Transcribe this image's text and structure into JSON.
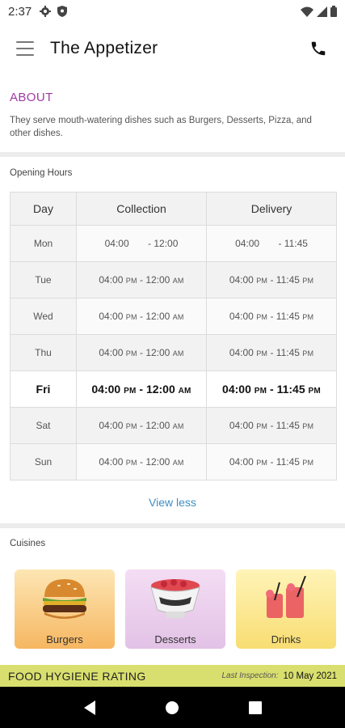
{
  "status_bar": {
    "time": "2:37"
  },
  "app_bar": {
    "title": "The Appetizer"
  },
  "about": {
    "heading": "ABOUT",
    "text": "They serve mouth-watering dishes such as Burgers, Desserts, Pizza, and other dishes."
  },
  "hours": {
    "label": "Opening Hours",
    "headers": {
      "day": "Day",
      "collection": "Collection",
      "delivery": "Delivery"
    },
    "rows": [
      {
        "day": "Mon",
        "c_open": "04:00",
        "c_open_ampm": "",
        "c_close": "- 12:00",
        "c_close_ampm": "",
        "d_open": "04:00",
        "d_open_ampm": "",
        "d_close": "- 11:45",
        "d_close_ampm": ""
      },
      {
        "day": "Tue",
        "c_open": "04:00",
        "c_open_ampm": "PM",
        "c_close": "- 12:00",
        "c_close_ampm": "AM",
        "d_open": "04:00",
        "d_open_ampm": "PM",
        "d_close": "- 11:45",
        "d_close_ampm": "PM"
      },
      {
        "day": "Wed",
        "c_open": "04:00",
        "c_open_ampm": "PM",
        "c_close": "- 12:00",
        "c_close_ampm": "AM",
        "d_open": "04:00",
        "d_open_ampm": "PM",
        "d_close": "- 11:45",
        "d_close_ampm": "PM"
      },
      {
        "day": "Thu",
        "c_open": "04:00",
        "c_open_ampm": "PM",
        "c_close": "- 12:00",
        "c_close_ampm": "AM",
        "d_open": "04:00",
        "d_open_ampm": "PM",
        "d_close": "- 11:45",
        "d_close_ampm": "PM"
      },
      {
        "day": "Fri",
        "c_open": "04:00",
        "c_open_ampm": "PM",
        "c_close": "- 12:00",
        "c_close_ampm": "AM",
        "d_open": "04:00",
        "d_open_ampm": "PM",
        "d_close": "- 11:45",
        "d_close_ampm": "PM"
      },
      {
        "day": "Sat",
        "c_open": "04:00",
        "c_open_ampm": "PM",
        "c_close": "- 12:00",
        "c_close_ampm": "AM",
        "d_open": "04:00",
        "d_open_ampm": "PM",
        "d_close": "- 11:45",
        "d_close_ampm": "PM"
      },
      {
        "day": "Sun",
        "c_open": "04:00",
        "c_open_ampm": "PM",
        "c_close": "- 12:00",
        "c_close_ampm": "AM",
        "d_open": "04:00",
        "d_open_ampm": "PM",
        "d_close": "- 11:45",
        "d_close_ampm": "PM"
      }
    ],
    "view_less": "View less"
  },
  "cuisines": {
    "label": "Cuisines",
    "items": [
      {
        "label": "Burgers"
      },
      {
        "label": "Desserts"
      },
      {
        "label": "Drinks"
      }
    ]
  },
  "hygiene": {
    "title": "FOOD HYGIENE RATING",
    "inspection_label": "Last Inspection:",
    "inspection_date": "10 May 2021"
  }
}
